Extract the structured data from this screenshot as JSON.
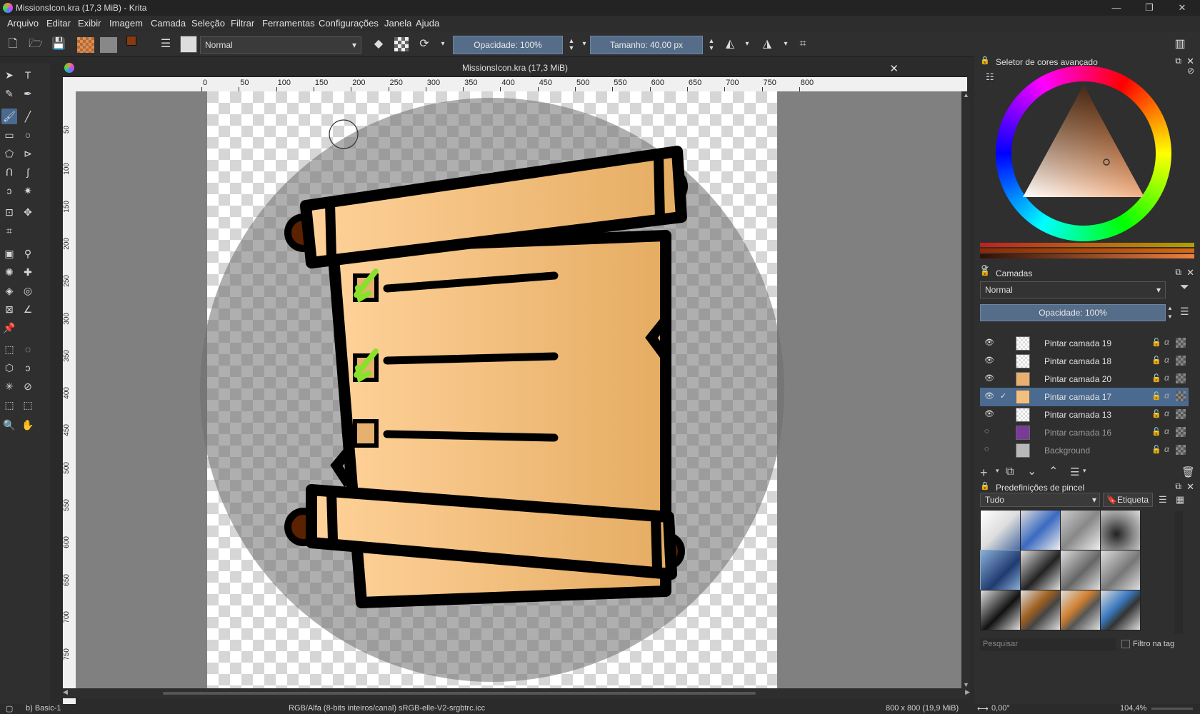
{
  "window": {
    "title": "MissionsIcon.kra (17,3 MiB) - Krita",
    "minimize": "—",
    "maximize": "❐",
    "close": "✕"
  },
  "menu": [
    "Arquivo",
    "Editar",
    "Exibir",
    "Imagem",
    "Camada",
    "Seleção",
    "Filtrar",
    "Ferramentas",
    "Configurações",
    "Janela",
    "Ajuda"
  ],
  "toolbar": {
    "blend_mode": "Normal",
    "opacity": "Opacidade: 100%",
    "size": "Tamanho: 40,00 px",
    "fg_color": "#8a3a10",
    "bg_color": "#ffffff"
  },
  "document": {
    "tab_title": "MissionsIcon.kra (17,3 MiB)",
    "close": "✕"
  },
  "rulers": {
    "h_labels": [
      "0",
      "50",
      "100",
      "150",
      "200",
      "250",
      "300",
      "350",
      "400",
      "450",
      "500",
      "550",
      "600",
      "650",
      "700",
      "750",
      "800"
    ],
    "v_labels": [
      "50",
      "100",
      "150",
      "200",
      "250",
      "300",
      "350",
      "400",
      "450",
      "500",
      "550",
      "600",
      "650",
      "700",
      "750"
    ]
  },
  "color_selector": {
    "title": "Seletor de cores avançado",
    "selected_color": "#c5651a"
  },
  "layers_panel": {
    "title": "Camadas",
    "blend_mode": "Normal",
    "opacity": "Opacidade:  100%",
    "layers": [
      {
        "name": "Pintar camada 19",
        "visible": true,
        "selected": false,
        "thumb": "checker"
      },
      {
        "name": "Pintar camada 18",
        "visible": true,
        "selected": false,
        "thumb": "checker"
      },
      {
        "name": "Pintar camada 20",
        "visible": true,
        "selected": false,
        "thumb": "#e8b070"
      },
      {
        "name": "Pintar camada 17",
        "visible": true,
        "selected": true,
        "thumb": "#f0c080"
      },
      {
        "name": "Pintar camada 13",
        "visible": true,
        "selected": false,
        "thumb": "checker"
      },
      {
        "name": "Pintar camada 16",
        "visible": false,
        "selected": false,
        "thumb": "#7a3a9a"
      },
      {
        "name": "Background",
        "visible": false,
        "selected": false,
        "thumb": "#b8b8b8"
      }
    ]
  },
  "brush_presets": {
    "title": "Predefinições de pincel",
    "filter": "Tudo",
    "tag_button": "Etiqueta",
    "search_placeholder": "Pesquisar",
    "tag_filter": "Filtro na tag"
  },
  "status": {
    "brush": "b) Basic-1",
    "color_space": "RGB/Alfa (8-bits inteiros/canal)  sRGB-elle-V2-srgbtrc.icc",
    "image_size": "800 x 800 (19,9 MiB)",
    "rotation": "0,00°",
    "zoom": "104,4%"
  }
}
